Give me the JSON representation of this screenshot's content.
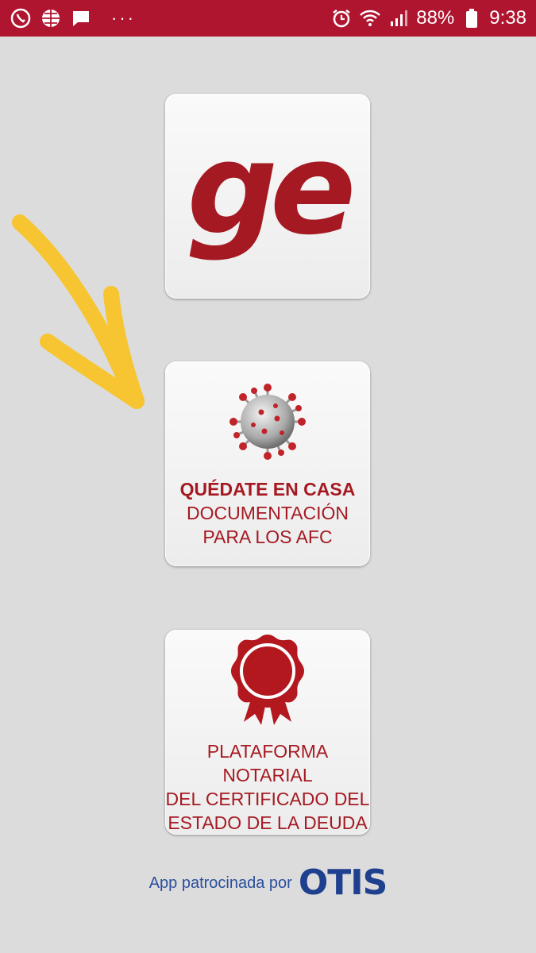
{
  "status_bar": {
    "battery_percent": "88%",
    "time": "9:38",
    "icons": [
      "whatsapp-icon",
      "globe-icon",
      "message-icon",
      "more-dots-icon",
      "alarm-icon",
      "wifi-icon",
      "signal-icon",
      "battery-icon"
    ]
  },
  "tiles": {
    "ge": {
      "logo_text": "ge"
    },
    "casa": {
      "title": "QUÉDATE EN CASA",
      "line2": "DOCUMENTACIÓN",
      "line3": "PARA LOS AFC"
    },
    "notarial": {
      "line1": "PLATAFORMA NOTARIAL",
      "line2": "DEL CERTIFICADO DEL",
      "line3": "ESTADO DE LA DEUDA"
    }
  },
  "sponsor": {
    "text": "App patrocinada por",
    "brand": "OTIS"
  },
  "colors": {
    "status_bar": "#b01530",
    "brand_red": "#a51a22",
    "background": "#dcdcdc",
    "otis_blue": "#1f3f8f",
    "annotation_yellow": "#f7c531"
  }
}
